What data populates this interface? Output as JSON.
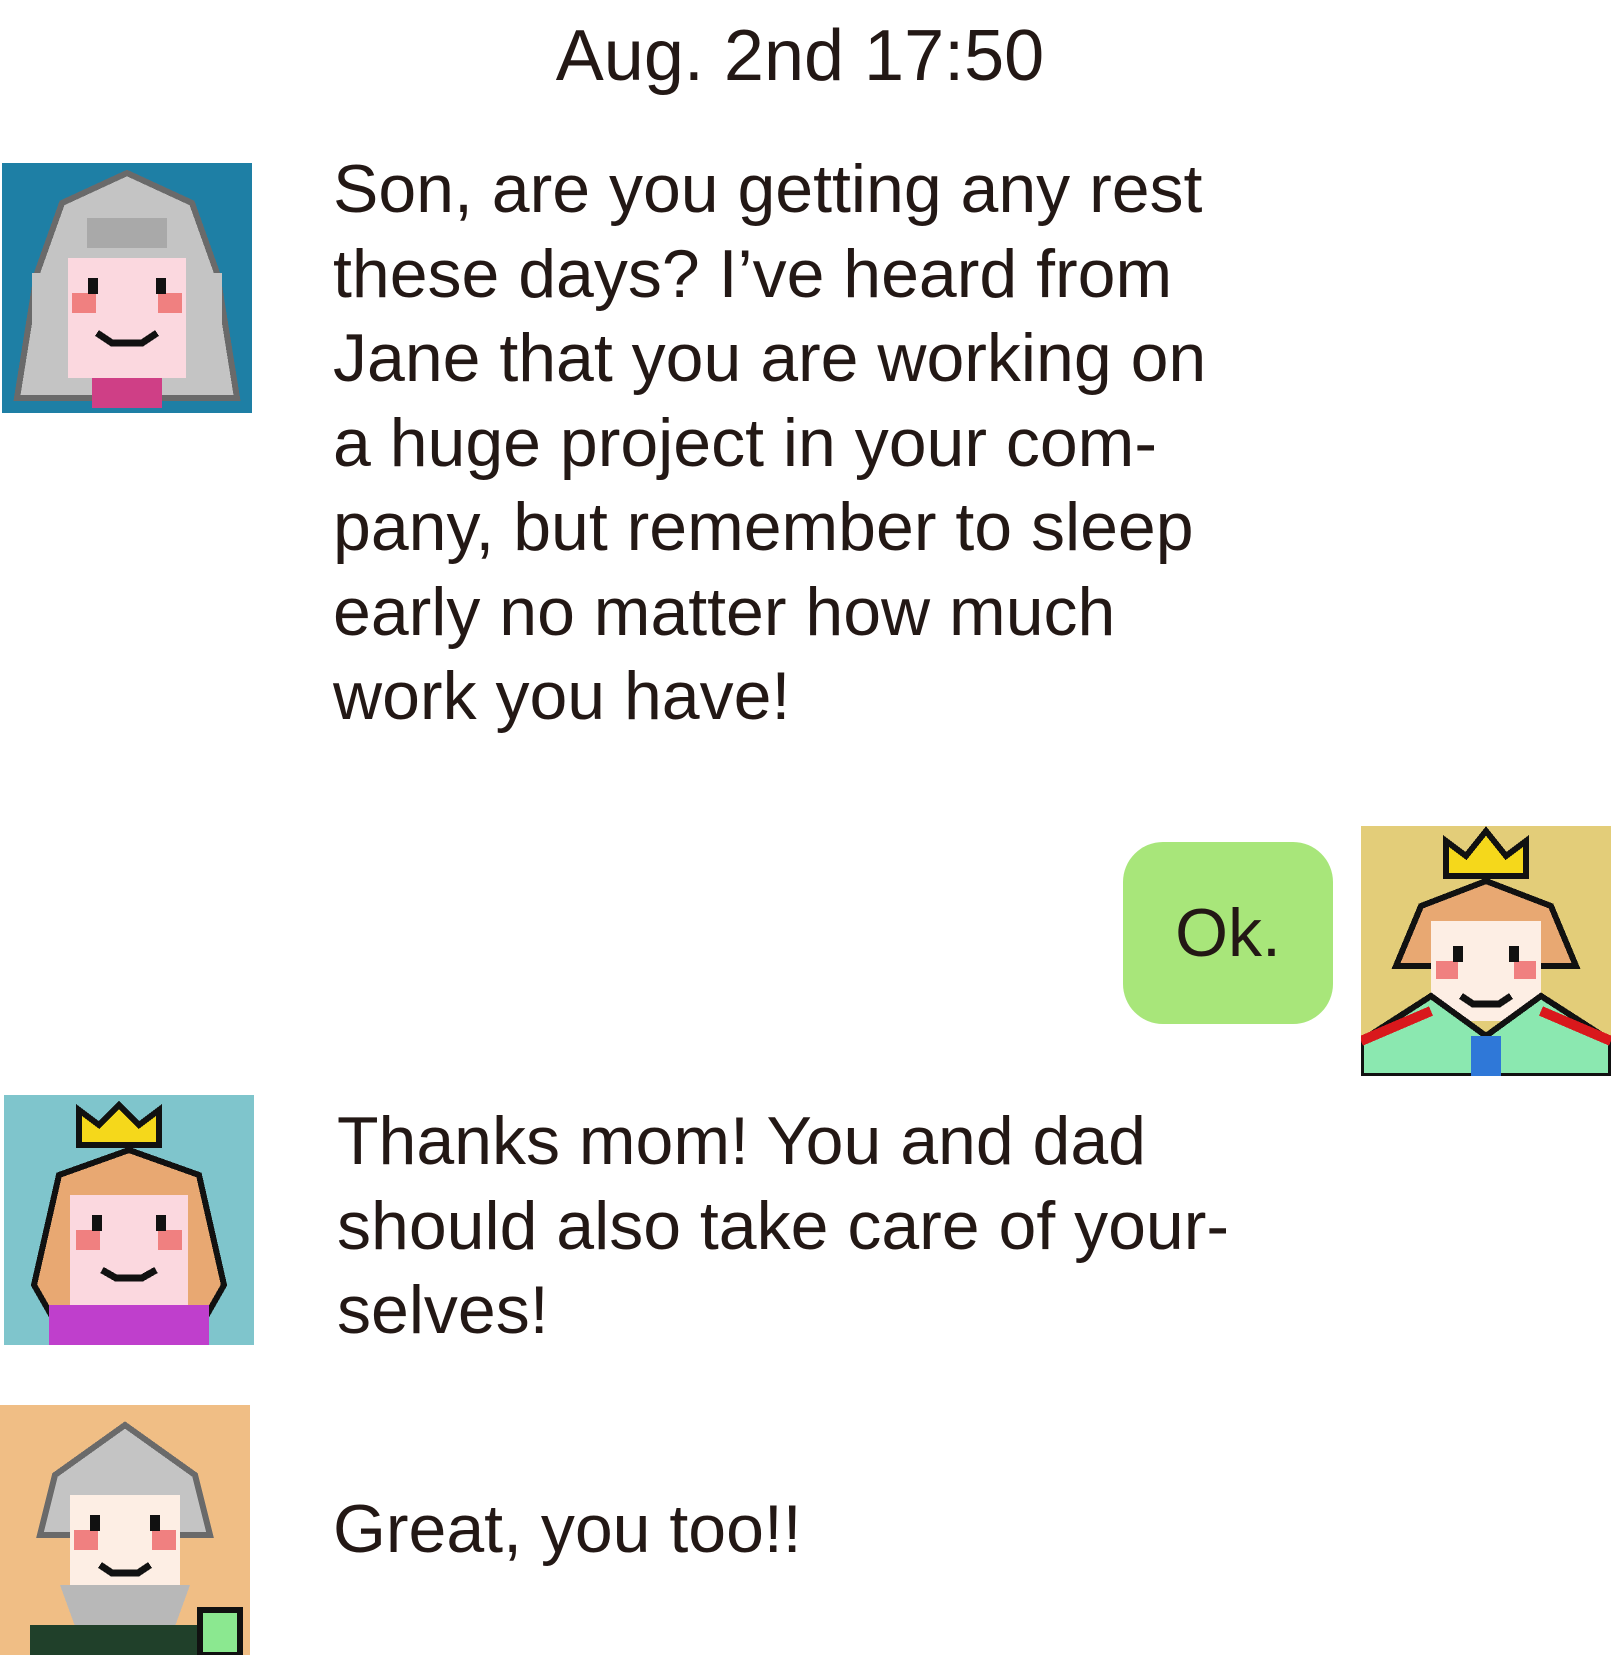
{
  "chat": {
    "timestamp": "Aug. 2nd 17:50",
    "messages": [
      {
        "sender": "grandmother",
        "side": "left",
        "avatar_icon": "grandmother-avatar-icon",
        "avatar_bg": "#1e7fa5",
        "text": "Son, are you getting any rest\nthese days? I’ve heard from\nJane that you are working on\na huge project in your com-\npany, but remember to sleep\nearly no matter how much\nwork you have!"
      },
      {
        "sender": "prince",
        "side": "right",
        "avatar_icon": "prince-avatar-icon",
        "avatar_bg": "#e3cd79",
        "bubble_color": "#a8e67a",
        "text": "Ok."
      },
      {
        "sender": "princess",
        "side": "left",
        "avatar_icon": "princess-avatar-icon",
        "avatar_bg": "#7fc5cc",
        "text": "Thanks mom! You and dad\nshould also take care of your-\nselves!"
      },
      {
        "sender": "grandfather",
        "side": "left",
        "avatar_icon": "grandfather-avatar-icon",
        "avatar_bg": "#f0be85",
        "text": "Great, you too!!"
      }
    ]
  }
}
